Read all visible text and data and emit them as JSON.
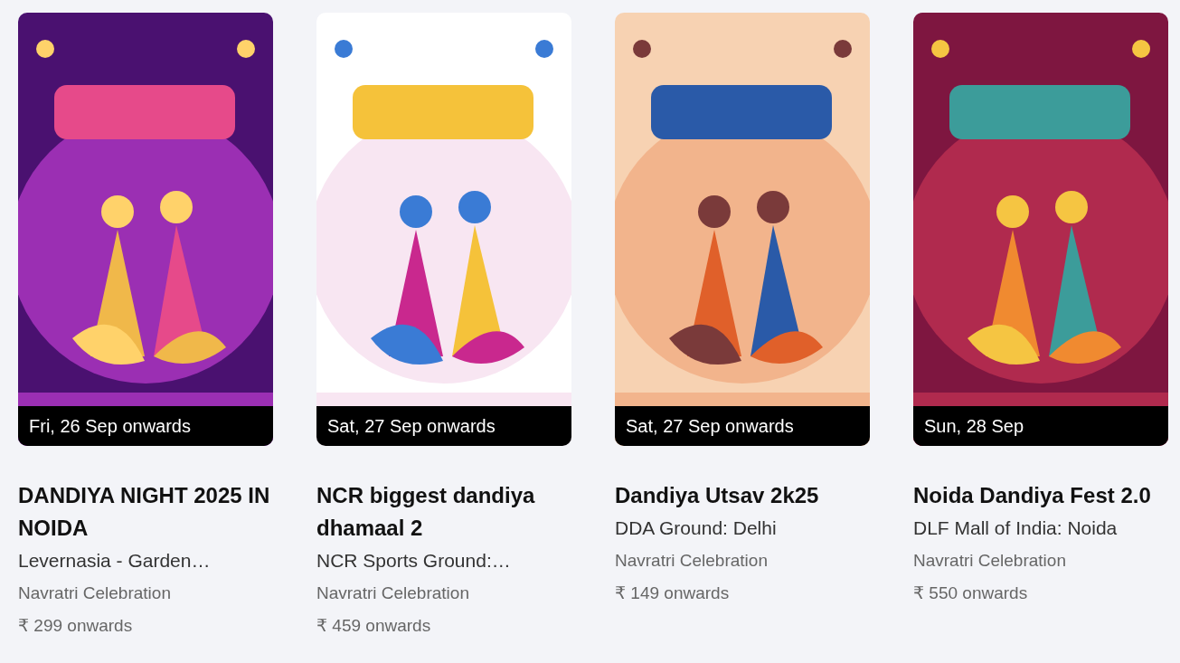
{
  "events": [
    {
      "date": "Fri, 26 Sep onwards",
      "title": "DANDIYA NIGHT 2025 IN NOIDA",
      "venue": "Levernasia - Garden…",
      "category": "Navratri Celebration",
      "price": "₹ 299 onwards"
    },
    {
      "date": "Sat, 27 Sep onwards",
      "title": "NCR biggest dandiya dhamaal 2",
      "venue": "NCR Sports Ground:…",
      "category": "Navratri Celebration",
      "price": "₹ 459 onwards"
    },
    {
      "date": "Sat, 27 Sep onwards",
      "title": "Dandiya Utsav 2k25",
      "venue": "DDA Ground: Delhi",
      "category": "Navratri Celebration",
      "price": "₹ 149 onwards"
    },
    {
      "date": "Sun, 28 Sep",
      "title": "Noida Dandiya Fest 2.0",
      "venue": "DLF Mall of India: Noida",
      "category": "Navratri Celebration",
      "price": "₹ 550 onwards"
    }
  ]
}
